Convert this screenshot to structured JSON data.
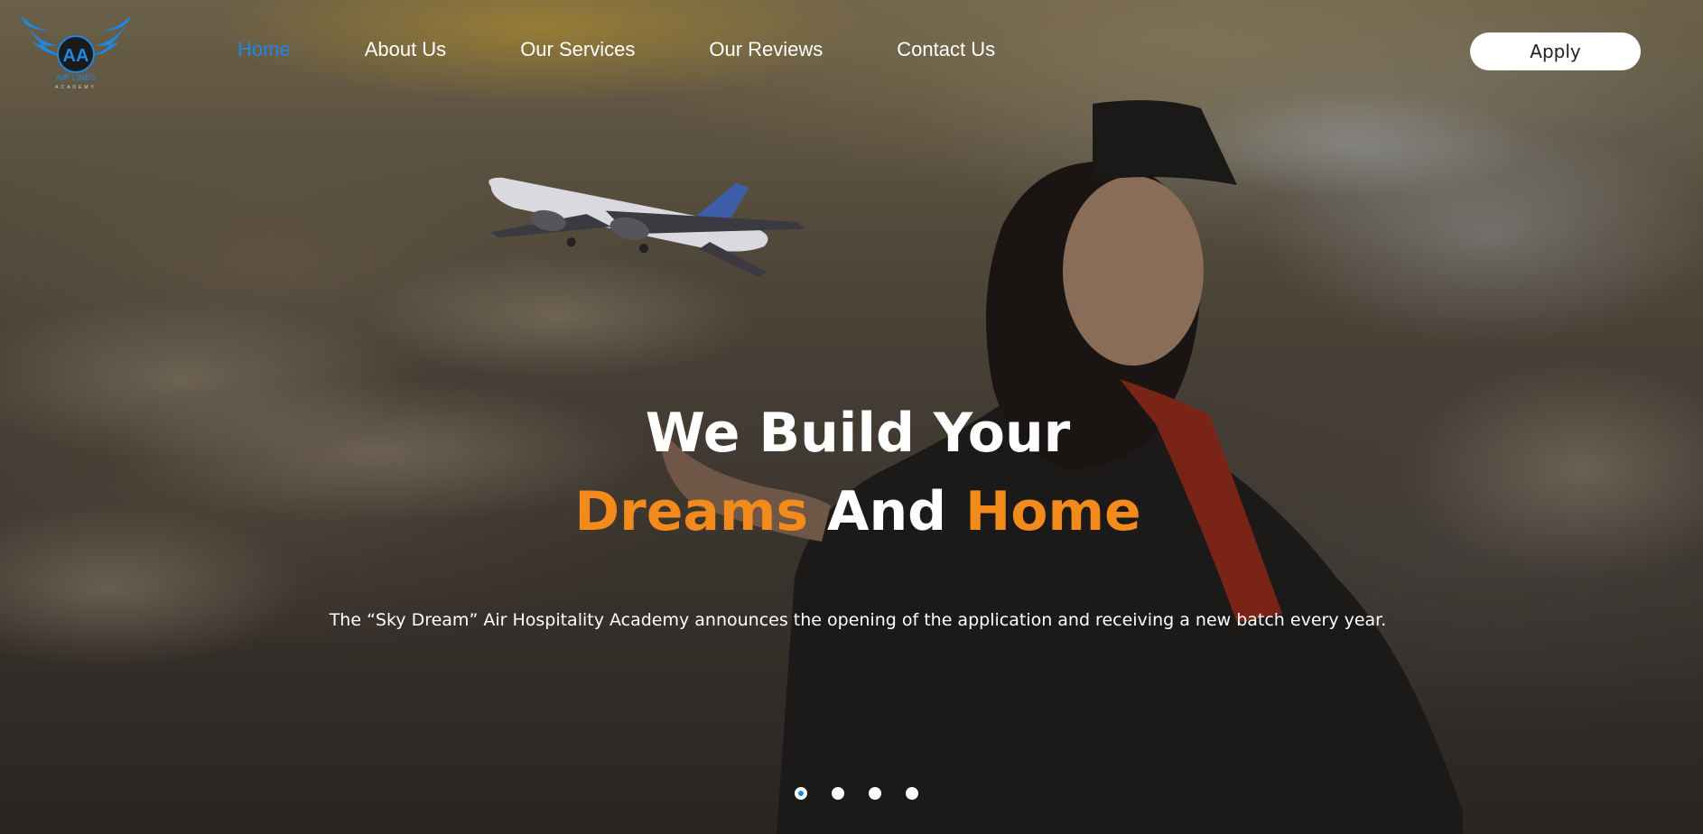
{
  "brand": {
    "logo_initials": "AA",
    "logo_line1": "AIR LINES",
    "logo_line2": "ACADEMY",
    "logo_icon": "winged-emblem-icon",
    "accent_color": "#1e88e5"
  },
  "nav": {
    "items": [
      {
        "label": "Home",
        "active": true
      },
      {
        "label": "About Us",
        "active": false
      },
      {
        "label": "Our Services",
        "active": false
      },
      {
        "label": "Our Reviews",
        "active": false
      },
      {
        "label": "Contact Us",
        "active": false
      }
    ],
    "apply_label": "Apply"
  },
  "hero": {
    "line1": "We Build Your",
    "line2_part1": "Dreams",
    "line2_part2": "And",
    "line2_part3": "Home",
    "highlight_color": "#f28a1c",
    "subtitle": "The “Sky Dream” Air Hospitality Academy announces the opening of the application and receiving a new batch every year."
  },
  "carousel": {
    "slide_count": 4,
    "active_index": 0
  }
}
